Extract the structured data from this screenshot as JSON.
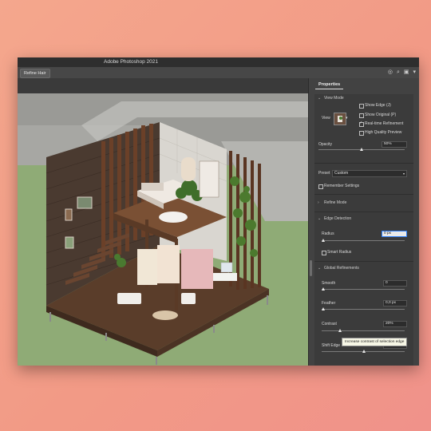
{
  "window": {
    "title": "Adobe Photoshop 2021"
  },
  "toolbar": {
    "mode_button": "Refine Hair"
  },
  "panel": {
    "tab": "Properties",
    "view_mode": {
      "heading": "View Mode",
      "view_label": "View",
      "options": [
        {
          "label": "Show Edge (J)",
          "checked": false
        },
        {
          "label": "Show Original (P)",
          "checked": false
        },
        {
          "label": "Real-time Refinement",
          "checked": true
        },
        {
          "label": "High Quality Preview",
          "checked": false
        }
      ],
      "opacity_label": "Opacity",
      "opacity_value": "50%",
      "opacity_fraction": 0.5
    },
    "preset": {
      "label": "Preset",
      "value": "Custom"
    },
    "remember": {
      "label": "Remember Settings",
      "checked": false
    },
    "sections": {
      "refine_mode": "Refine Mode",
      "edge_detection": "Edge Detection",
      "global_refinements": "Global Refinements"
    },
    "edge_detection": {
      "radius_label": "Radius",
      "radius_value": "0 px",
      "smart_radius_label": "Smart Radius"
    },
    "global_refinements": {
      "smooth_label": "Smooth",
      "smooth_value": "0",
      "feather_label": "Feather",
      "feather_value": "0,0 px",
      "contrast_label": "Contrast",
      "contrast_value": "20%",
      "shift_edge_label": "Shift Edge",
      "shift_edge_value": "0%"
    },
    "tooltip": "Increase contrast of selection edge"
  }
}
